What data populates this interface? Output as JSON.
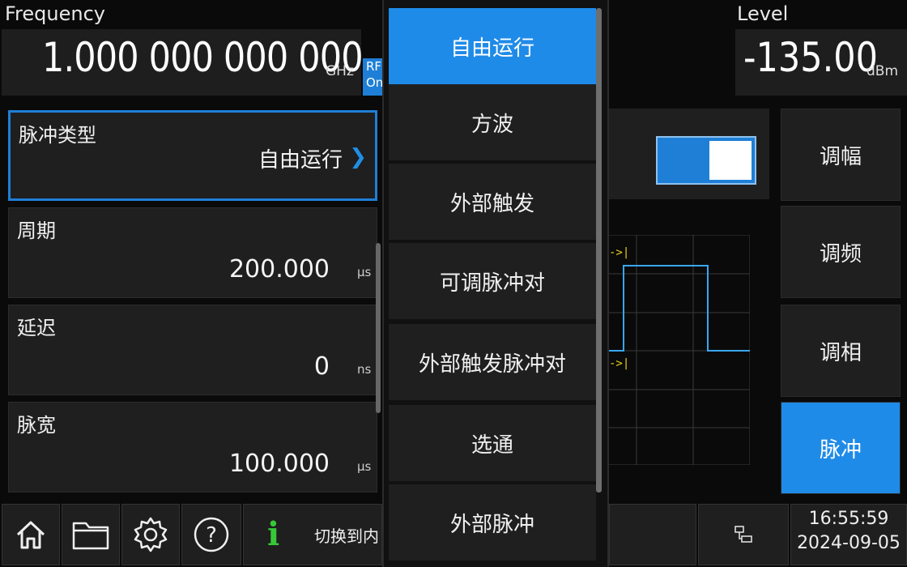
{
  "header": {
    "frequency_label": "Frequency",
    "frequency_value": "1.000 000 000 000",
    "frequency_unit": "GHz",
    "rf_badge": "RF On",
    "level_label": "Level",
    "level_value": "-135.00",
    "level_unit": "dBm"
  },
  "params": [
    {
      "name": "脉冲类型",
      "value": "自由运行",
      "unit": ""
    },
    {
      "name": "周期",
      "value": "200.000",
      "unit": "μs"
    },
    {
      "name": "延迟",
      "value": "0",
      "unit": "ns"
    },
    {
      "name": "脉宽",
      "value": "100.000",
      "unit": "μs"
    }
  ],
  "dropdown": {
    "options": [
      "自由运行",
      "方波",
      "外部触发",
      "可调脉冲对",
      "外部触发脉冲对",
      "选通",
      "外部脉冲"
    ],
    "selected": "自由运行"
  },
  "right_menu": {
    "items": [
      "调幅",
      "调频",
      "调相",
      "脉冲"
    ],
    "active": "脉冲"
  },
  "preview": {
    "marker_label": "->|",
    "toggle_state": "on"
  },
  "status": {
    "message": "切换到内",
    "time": "16:55:59",
    "date": "2024-09-05"
  },
  "colors": {
    "accent": "#1f8be8",
    "info_icon": "#37c837",
    "trace": "#3aa6f0",
    "marker": "#e6d21e"
  },
  "icons": {
    "home": "home-icon",
    "folder": "folder-icon",
    "settings": "gear-icon",
    "help": "help-icon",
    "info": "info-icon",
    "network": "network-icon"
  }
}
